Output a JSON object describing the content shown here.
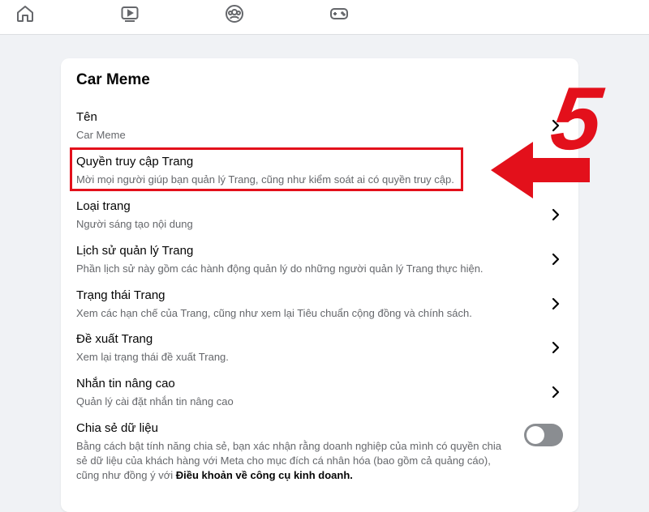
{
  "nav": {
    "icons": [
      "home-icon",
      "video-icon",
      "groups-icon",
      "gaming-icon"
    ]
  },
  "panel": {
    "title": "Car Meme",
    "items": [
      {
        "title": "Tên",
        "subtitle": "Car Meme"
      },
      {
        "title": "Quyền truy cập Trang",
        "subtitle": "Mời mọi người giúp bạn quản lý Trang, cũng như kiểm soát ai có quyền truy cập."
      },
      {
        "title": "Loại trang",
        "subtitle": "Người sáng tạo nội dung"
      },
      {
        "title": "Lịch sử quản lý Trang",
        "subtitle": "Phần lịch sử này gồm các hành động quản lý do những người quản lý Trang thực hiện."
      },
      {
        "title": "Trạng thái Trang",
        "subtitle": "Xem các hạn chế của Trang, cũng như xem lại Tiêu chuẩn cộng đồng và chính sách."
      },
      {
        "title": "Đề xuất Trang",
        "subtitle": "Xem lại trạng thái đề xuất Trang."
      },
      {
        "title": "Nhắn tin nâng cao",
        "subtitle": "Quản lý cài đặt nhắn tin nâng cao"
      }
    ],
    "share": {
      "title": "Chia sẻ dữ liệu",
      "description": "Bằng cách bật tính năng chia sẻ, bạn xác nhận rằng doanh nghiệp của mình có quyền chia sẻ dữ liệu của khách hàng với Meta cho mục đích cá nhân hóa (bao gồm cả quảng cáo), cũng như đồng ý với ",
      "terms_link": "Điều khoản về công cụ kinh doanh.",
      "enabled": false
    }
  },
  "annotation": {
    "step": "5",
    "color": "#e3101b"
  }
}
